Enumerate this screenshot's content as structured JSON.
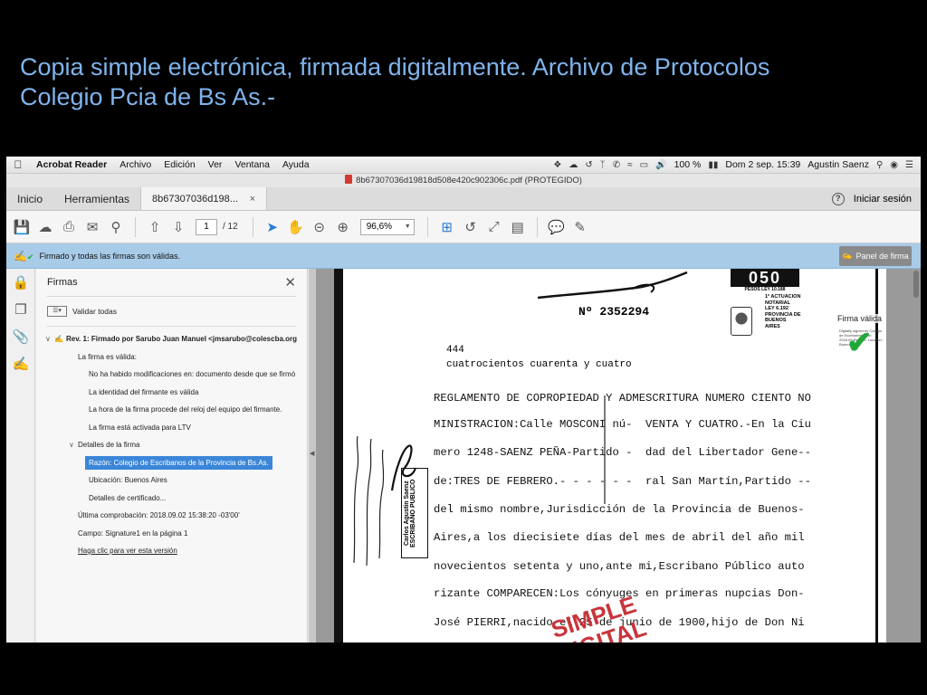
{
  "slide": {
    "title_line1": "Copia simple electrónica, firmada digitalmente. Archivo de Protocolos",
    "title_line2": "Colegio Pcia de Bs As.-"
  },
  "menubar": {
    "app": "Acrobat Reader",
    "items": [
      "Archivo",
      "Edición",
      "Ver",
      "Ventana",
      "Ayuda"
    ],
    "battery": "100 %",
    "datetime": "Dom 2 sep.  15:39",
    "user": "Agustin Saenz"
  },
  "window": {
    "title": "8b67307036d19818d508e420c902306c.pdf (PROTEGIDO)"
  },
  "tabs": {
    "home": "Inicio",
    "tools": "Herramientas",
    "doc": "8b67307036d198...",
    "signin": "Iniciar sesión"
  },
  "toolbar": {
    "page_current": "1",
    "page_total": "/ 12",
    "zoom": "96,6%"
  },
  "sigbar": {
    "message": "Firmado y todas las firmas son válidas.",
    "panel_button": "Panel de firma"
  },
  "signatures_panel": {
    "title": "Firmas",
    "validate_all": "Validar todas",
    "rows": [
      {
        "text": "Rev. 1: Firmado por Sarubo Juan Manuel <jmsarubo@colescba.org"
      },
      {
        "text": "La firma es válida:"
      },
      {
        "text": "No ha habido modificaciones en: documento desde que se firmó"
      },
      {
        "text": "La identidad del firmante es válida"
      },
      {
        "text": "La hora de la firma procede del reloj del equipo del firmante."
      },
      {
        "text": "La firma está activada para LTV"
      },
      {
        "text": "Detalles de la firma"
      },
      {
        "text": "Razón: Colegio de Escribanos de la Provincia de Bs.As."
      },
      {
        "text": "Ubicación: Buenos Aires"
      },
      {
        "text": "Detalles de certificado..."
      },
      {
        "text": "Última comprobación: 2018.09.02 15:38:20 -03'00'"
      },
      {
        "text": "Campo: Signature1 en la página 1"
      },
      {
        "text": "Haga clic para ver esta versión"
      }
    ]
  },
  "document": {
    "stamp_number": "050",
    "stamp_sub": "PESOS LEY 10.188",
    "stamp_text": "1ª ACTUACION NOTARIAL LEY 6.192 PROVINCIA DE BUENOS AIRES",
    "serial": "Nº  2352294",
    "n444": "444",
    "cuatrocientos": "cuatrocientos cuarenta y cuatro",
    "lines": [
      "REGLAMENTO DE COPROPIEDAD Y ADMESCRITURA NUMERO CIENTO NO",
      "MINISTRACION:Calle MOSCONI nú-  VENTA Y CUATRO.-En la Ciu",
      "mero 1248-SAENZ PEÑA-Partido -  dad del Libertador Gene--",
      "de:TRES DE FEBRERO.- - - - - -  ral San Martín,Partido --",
      "del mismo nombre,Jurisdicción de la Provincia de Buenos-",
      "Aires,a los diecisiete días del mes de abril del año mil",
      "novecientos setenta y uno,ante mi,Escribano Público auto",
      "rizante COMPARECEN:Los cónyuges en primeras nupcias Don-",
      "José PIERRI,nacido el 25 de junio de 1900,hijo de Don Ni"
    ],
    "escribano_box": "Carlos Agustin Saenz ESCRIBANO PUBLICO",
    "firma_valida": "Firma válida",
    "firma_small": "Digitally signed by Colegio de Escribanos Date: 2018.09 Reason: Location: Buenos Aires",
    "watermark_1": "SIMPLE",
    "watermark_2": "DIGITAL"
  }
}
